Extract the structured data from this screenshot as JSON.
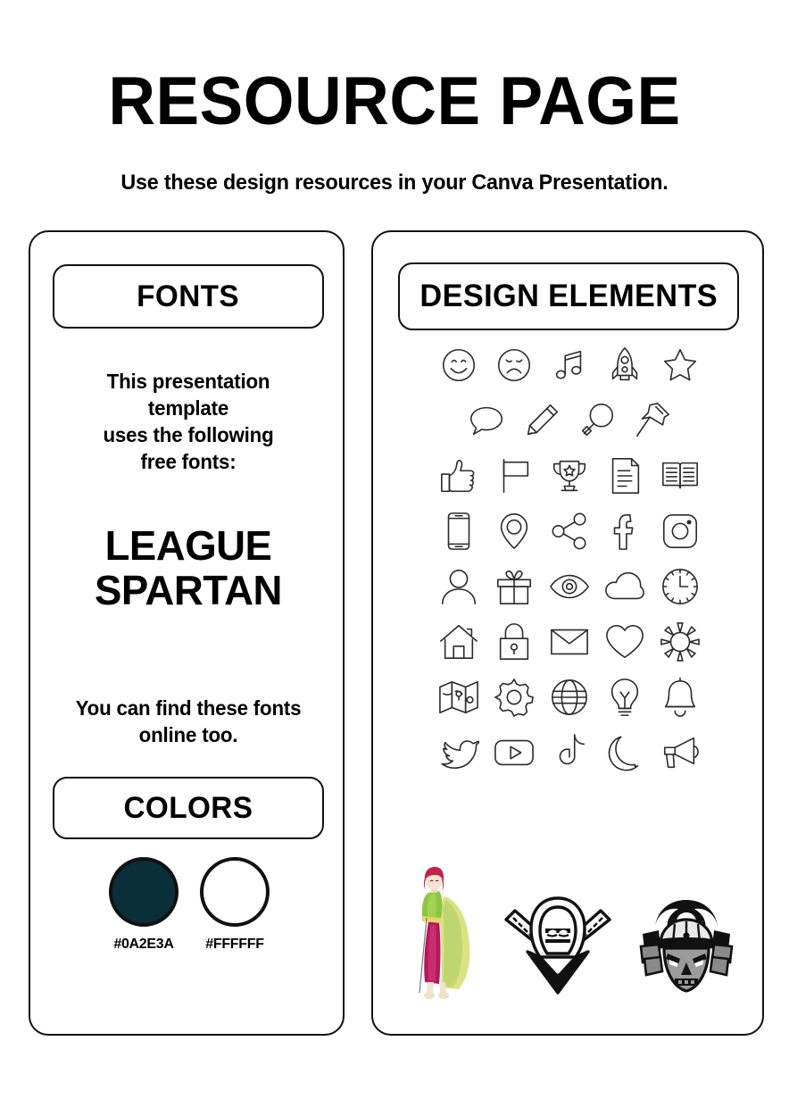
{
  "header": {
    "title": "RESOURCE PAGE",
    "subtitle": "Use these design resources in your Canva Presentation."
  },
  "fonts_card": {
    "heading": "FONTS",
    "intro_lines": [
      "This presentation",
      "template",
      "uses the following",
      "free fonts:"
    ],
    "intro_text": "This presentation template uses the following free fonts:",
    "font_name_lines": [
      "LEAGUE",
      "SPARTAN"
    ],
    "font_name": "LEAGUE SPARTAN",
    "note_lines": [
      "You can find these fonts",
      "online too."
    ],
    "note_text": "You can find these fonts online too.",
    "colors_heading": "COLORS",
    "swatches": [
      {
        "hex": "#0A2E3A",
        "label": "#0A2E3A",
        "fill": "#0A2E3A",
        "ring": "#111111"
      },
      {
        "hex": "#FFFFFF",
        "label": "#FFFFFF",
        "fill": "#FFFFFF",
        "ring": "#111111"
      }
    ]
  },
  "design_card": {
    "heading": "DESIGN ELEMENTS",
    "icon_rows": [
      [
        "smiley-face-icon",
        "sad-face-icon",
        "music-notes-icon",
        "rocket-icon",
        "star-icon"
      ],
      [
        "speech-bubble-icon",
        "pencil-icon",
        "magnifying-glass-icon",
        "pushpin-icon"
      ],
      [
        "thumbs-up-icon",
        "flag-icon",
        "trophy-icon",
        "document-icon",
        "open-book-icon"
      ],
      [
        "mobile-phone-icon",
        "location-pin-icon",
        "share-icon",
        "facebook-icon",
        "instagram-icon"
      ],
      [
        "user-icon",
        "gift-icon",
        "eye-icon",
        "cloud-icon",
        "clock-icon"
      ],
      [
        "home-icon",
        "lock-icon",
        "envelope-icon",
        "heart-icon",
        "sun-icon"
      ],
      [
        "map-icon",
        "gear-icon",
        "globe-icon",
        "lightbulb-icon",
        "bell-icon"
      ],
      [
        "twitter-bird-icon",
        "youtube-icon",
        "tiktok-icon",
        "moon-icon",
        "megaphone-icon"
      ]
    ],
    "illustrations": [
      {
        "name": "anime-girl-illustration",
        "colors": [
          "#c0224a",
          "#8cc63f",
          "#d9e07a",
          "#b5195a"
        ]
      },
      {
        "name": "ninja-swords-illustration",
        "colors": [
          "#111111"
        ]
      },
      {
        "name": "samurai-helmet-illustration",
        "colors": [
          "#111111",
          "#8a8a8a"
        ]
      }
    ]
  },
  "theme": {
    "page_background": "#FFFFFF",
    "ink": "#000000",
    "icon_stroke": "#2B2B2B",
    "card_border": "#111111"
  }
}
